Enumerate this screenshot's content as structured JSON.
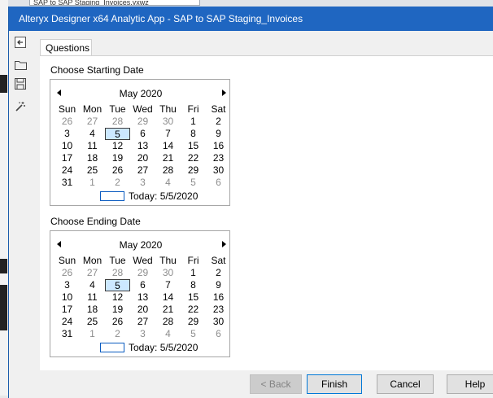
{
  "background": {
    "tab_text": "SAP to SAP Staging_Invoices.yxwz"
  },
  "window": {
    "title": "Alteryx Designer x64 Analytic App - SAP to SAP Staging_Invoices"
  },
  "toolbar": {
    "items": [
      {
        "icon": "back-arrow-icon"
      },
      {
        "icon": "folder-icon"
      },
      {
        "icon": "save-icon"
      },
      {
        "icon": "magic-wand-icon"
      }
    ]
  },
  "tabs": [
    {
      "label": "Questions",
      "selected": true
    }
  ],
  "start_date": {
    "label": "Choose Starting Date",
    "month_label": "May 2020",
    "weekdays": [
      "Sun",
      "Mon",
      "Tue",
      "Wed",
      "Thu",
      "Fri",
      "Sat"
    ],
    "days": [
      [
        "26",
        "27",
        "28",
        "29",
        "30",
        "1",
        "2"
      ],
      [
        "3",
        "4",
        "5",
        "6",
        "7",
        "8",
        "9"
      ],
      [
        "10",
        "11",
        "12",
        "13",
        "14",
        "15",
        "16"
      ],
      [
        "17",
        "18",
        "19",
        "20",
        "21",
        "22",
        "23"
      ],
      [
        "24",
        "25",
        "26",
        "27",
        "28",
        "29",
        "30"
      ],
      [
        "31",
        "1",
        "2",
        "3",
        "4",
        "5",
        "6"
      ]
    ],
    "selected_day": "5",
    "today_label": "Today: 5/5/2020"
  },
  "end_date": {
    "label": "Choose Ending Date",
    "month_label": "May 2020",
    "weekdays": [
      "Sun",
      "Mon",
      "Tue",
      "Wed",
      "Thu",
      "Fri",
      "Sat"
    ],
    "days": [
      [
        "26",
        "27",
        "28",
        "29",
        "30",
        "1",
        "2"
      ],
      [
        "3",
        "4",
        "5",
        "6",
        "7",
        "8",
        "9"
      ],
      [
        "10",
        "11",
        "12",
        "13",
        "14",
        "15",
        "16"
      ],
      [
        "17",
        "18",
        "19",
        "20",
        "21",
        "22",
        "23"
      ],
      [
        "24",
        "25",
        "26",
        "27",
        "28",
        "29",
        "30"
      ],
      [
        "31",
        "1",
        "2",
        "3",
        "4",
        "5",
        "6"
      ]
    ],
    "selected_day": "5",
    "today_label": "Today: 5/5/2020"
  },
  "buttons": {
    "back": "< Back",
    "finish": "Finish",
    "cancel": "Cancel",
    "help": "Help"
  },
  "colors": {
    "titlebar": "#1f66c1",
    "selection_fill": "#cce8ff",
    "today_outline": "#0b5cc0"
  }
}
